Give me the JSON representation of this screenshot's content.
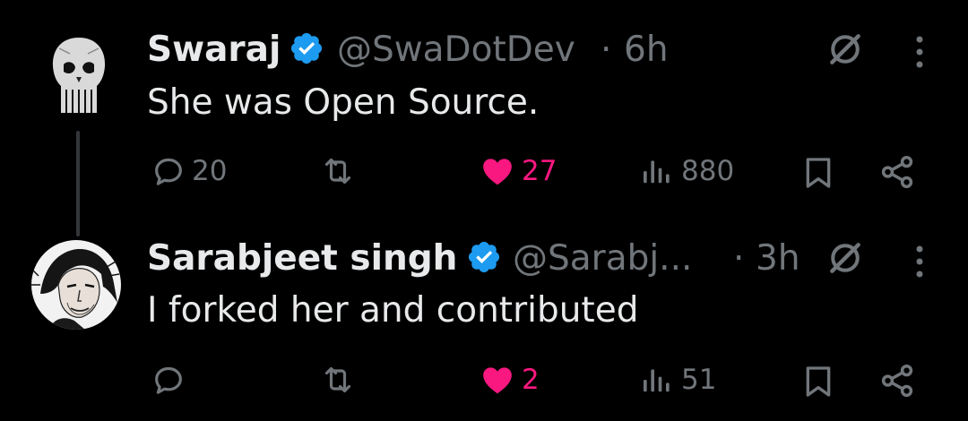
{
  "tweets": [
    {
      "name": "Swaraj",
      "handle": "@SwaDotDev",
      "separator": "·",
      "time": "6h",
      "text": "She was Open Source.",
      "avatar_icon": "punisher-skull-avatar",
      "verified": true,
      "actions": {
        "replies": "20",
        "retweets": "",
        "likes": "27",
        "liked": true,
        "views": "880"
      }
    },
    {
      "name": "Sarabjeet singh",
      "handle": "@Sarabj...",
      "separator": "·",
      "time": "3h",
      "text": "I forked her and contributed",
      "avatar_icon": "sketch-portrait-avatar",
      "verified": true,
      "actions": {
        "replies": "",
        "retweets": "",
        "likes": "2",
        "liked": true,
        "views": "51"
      }
    }
  ],
  "colors": {
    "background": "#000000",
    "primary_text": "#e7e9ea",
    "secondary_text": "#71767b",
    "like": "#f91880",
    "verified": "#1d9bf0",
    "thread_line": "#333639"
  },
  "icons": [
    "reply-icon",
    "retweet-icon",
    "like-icon",
    "views-icon",
    "bookmark-icon",
    "share-icon",
    "grok-icon",
    "more-icon",
    "verified-icon"
  ]
}
